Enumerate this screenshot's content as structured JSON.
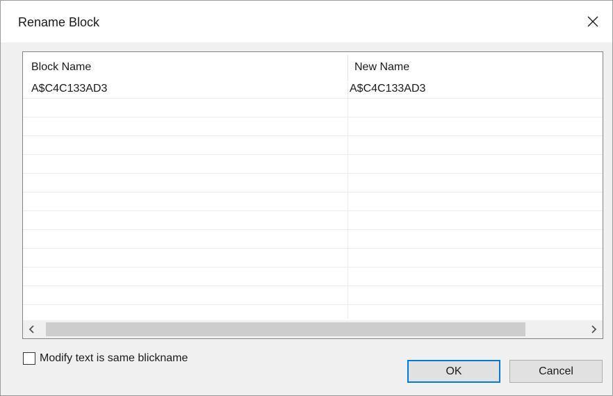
{
  "dialog": {
    "title": "Rename Block",
    "close_icon": "close-icon"
  },
  "grid": {
    "columns": [
      "Block Name",
      "New Name"
    ],
    "rows": [
      {
        "block_name": "A$C4C133AD3",
        "new_name": "A$C4C133AD3"
      },
      {
        "block_name": "",
        "new_name": ""
      },
      {
        "block_name": "",
        "new_name": ""
      },
      {
        "block_name": "",
        "new_name": ""
      },
      {
        "block_name": "",
        "new_name": ""
      },
      {
        "block_name": "",
        "new_name": ""
      },
      {
        "block_name": "",
        "new_name": ""
      },
      {
        "block_name": "",
        "new_name": ""
      },
      {
        "block_name": "",
        "new_name": ""
      },
      {
        "block_name": "",
        "new_name": ""
      },
      {
        "block_name": "",
        "new_name": ""
      },
      {
        "block_name": "",
        "new_name": ""
      }
    ],
    "scroll_left_icon": "chevron-left-icon",
    "scroll_right_icon": "chevron-right-icon"
  },
  "options": {
    "modify_text_label": "Modify text is same blickname",
    "modify_text_checked": false
  },
  "buttons": {
    "ok_label": "OK",
    "cancel_label": "Cancel"
  },
  "colors": {
    "focus_border": "#0078d7",
    "dialog_bg": "#f0f0f0"
  }
}
